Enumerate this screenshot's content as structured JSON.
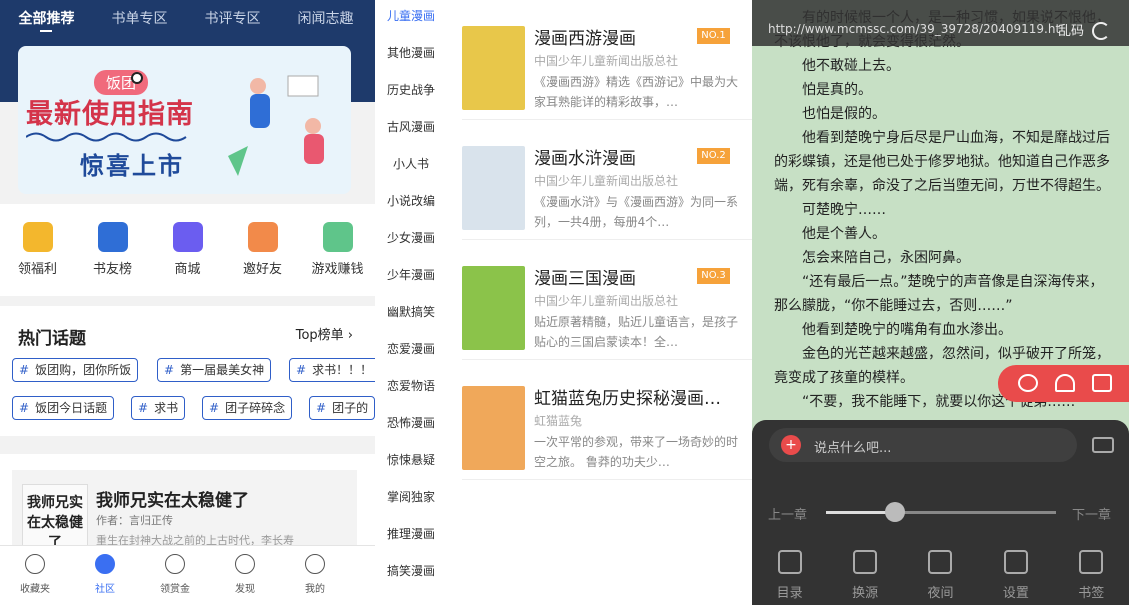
{
  "panel1": {
    "tabs": [
      "全部推荐",
      "书单专区",
      "书评专区",
      "闲闻志趣"
    ],
    "banner": {
      "pill": "饭团",
      "title": "最新使用指南",
      "subtitle": "惊喜上市"
    },
    "grid": [
      {
        "label": "领福利",
        "color": "#f3b72d"
      },
      {
        "label": "书友榜",
        "color": "#2f6ed6"
      },
      {
        "label": "商城",
        "color": "#6b5df0"
      },
      {
        "label": "邀好友",
        "color": "#f28a4a"
      },
      {
        "label": "游戏赚钱",
        "color": "#5fc58a"
      }
    ],
    "hot_title": "热门话题",
    "hot_rank": "Top榜单 ›",
    "chips": [
      "饭团购，团你所饭",
      "第一届最美女神",
      "求书！！！",
      "饭团今日话题",
      "求书",
      "团子碎碎念",
      "团子的"
    ],
    "book": {
      "cover_text": "我师兄实在太稳健了",
      "title": "我师兄实在太稳健了",
      "author": "作者：言归正传",
      "desc": "重生在封神大战之前的上古时代，李长寿"
    },
    "nav": [
      {
        "label": "收藏夹",
        "active": false
      },
      {
        "label": "社区",
        "active": true
      },
      {
        "label": "领赏金",
        "active": false
      },
      {
        "label": "发现",
        "active": false
      },
      {
        "label": "我的",
        "active": false
      }
    ]
  },
  "panel2": {
    "categories": [
      "儿童漫画",
      "其他漫画",
      "历史战争",
      "古风漫画",
      "小人书",
      "小说改编",
      "少女漫画",
      "少年漫画",
      "幽默搞笑",
      "恋爱漫画",
      "恋爱物语",
      "恐怖漫画",
      "惊悚悬疑",
      "掌阅独家",
      "推理漫画",
      "搞笑漫画"
    ],
    "books": [
      {
        "title": "漫画西游漫画",
        "pub": "中国少年儿童新闻出版总社",
        "desc": "《漫画西游》精选《西游记》中最为大家耳熟能详的精彩故事，…",
        "rank": "NO.1",
        "cover": "#e8c74a"
      },
      {
        "title": "漫画水浒漫画",
        "pub": "中国少年儿童新闻出版总社",
        "desc": "《漫画水浒》与《漫画西游》为同一系列，一共4册，每册4个…",
        "rank": "NO.2",
        "cover": "#d9e3ec"
      },
      {
        "title": "漫画三国漫画",
        "pub": "中国少年儿童新闻出版总社",
        "desc": "贴近原著精髓，贴近儿童语言，是孩子贴心的三国启蒙读本！全…",
        "rank": "NO.3",
        "cover": "#8bc34a"
      },
      {
        "title": "虹猫蓝兔历史探秘漫画…",
        "pub": "虹猫蓝兔",
        "desc": "一次平常的参观，带来了一场奇妙的时空之旅。 鲁莽的功夫少…",
        "rank": "",
        "cover": "#f0a85a"
      }
    ]
  },
  "panel3": {
    "url": "http://www.mcmssc.com/39_39728/20409119.ht",
    "garble": "乱码",
    "paragraphs": [
      "有的时候恨一个人，是一种习惯，如果说不恨他，不该恨他了，就会变得很茫然。",
      "他不敢碰上去。",
      "怕是真的。",
      "也怕是假的。",
      "他看到楚晚宁身后尽是尸山血海，不知是靡战过后的彩蝶镇，还是他已处于修罗地狱。他知道自己作恶多端，死有余辜，命没了之后当堕无间，万世不得超生。",
      "可楚晚宁……",
      "他是个善人。",
      "怎会来陪自己，永困阿鼻。",
      "“还有最后一点。”楚晚宁的声音像是自深海传来，那么朦胧，“你不能睡过去，否则……”",
      "他看到楚晚宁的嘴角有血水渗出。",
      "金色的光芒越来越盛，忽然间，似乎破开了所笼，竟变成了孩童的模样。",
      "“不要，我不能睡下，就要以你这个徒弟……”"
    ],
    "comment_placeholder": "说点什么吧...",
    "prev": "上一章",
    "next": "下一章",
    "progress": 0.3,
    "tools": [
      "目录",
      "换源",
      "夜间",
      "设置",
      "书签"
    ]
  }
}
